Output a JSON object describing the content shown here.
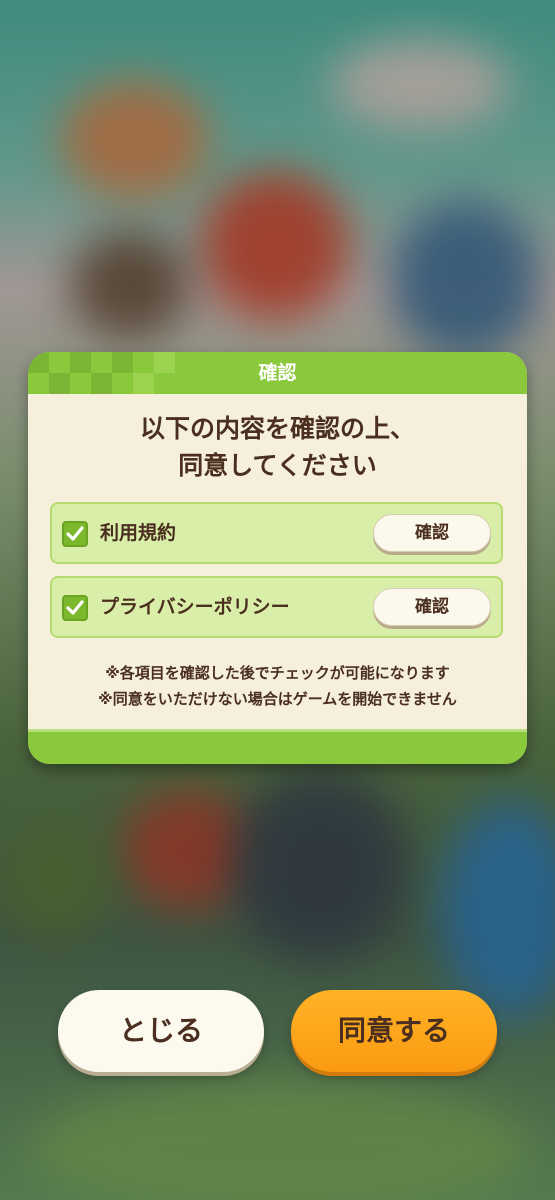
{
  "dialog": {
    "title": "確認",
    "message_line1": "以下の内容を確認の上、",
    "message_line2": "同意してください",
    "items": [
      {
        "label": "利用規約",
        "checked": true,
        "button_label": "確認"
      },
      {
        "label": "プライバシーポリシー",
        "checked": true,
        "button_label": "確認"
      }
    ],
    "note_line1": "※各項目を確認した後でチェックが可能になります",
    "note_line2": "※同意をいただけない場合はゲームを開始できません"
  },
  "buttons": {
    "close_label": "とじる",
    "agree_label": "同意する"
  },
  "colors": {
    "header_green": "#8ac83c",
    "dialog_bg": "#f5efdc",
    "row_bg": "#d9eea8",
    "text_brown": "#4a2e1f",
    "agree_orange": "#fba31a"
  }
}
